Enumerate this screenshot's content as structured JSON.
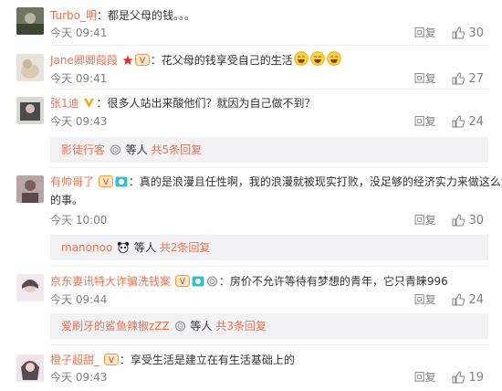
{
  "comments": [
    {
      "username": "Turbo_明",
      "text": "：都是父母的钱。。。",
      "time": "今天 09:41",
      "reply_label": "回复",
      "likes": "30",
      "emoji_count": 0
    },
    {
      "username": "Jane卿卿葭葭",
      "text": "：花父母的钱享受自己的生活",
      "time": "今天 09:41",
      "reply_label": "回复",
      "likes": "27",
      "emoji_count": 3
    },
    {
      "username": "张1迪",
      "text": "：很多人站出来酸他们？就因为自己做不到？",
      "time": "今天 09:43",
      "reply_label": "回复",
      "likes": "24",
      "sub": {
        "username": "影徒行客",
        "people_label": "等人",
        "count_label": "共5条回复"
      }
    },
    {
      "username": "有帅哥了",
      "text": "：真的是浪漫且任性啊，我的浪漫就被现实打败，没足够的经济实力来做这么浪漫",
      "text2": "的事。",
      "time": "今天 10:00",
      "reply_label": "回复",
      "likes": "30",
      "sub": {
        "username": "manonoo",
        "people_label": "等人",
        "count_label": "共2条回复"
      }
    },
    {
      "username": "京东妻讯特大诈骗洗钱案",
      "text": "：房价不允许等待有梦想的青年，它只青睐996",
      "time": "今天 09:44",
      "reply_label": "回复",
      "likes": "24",
      "sub": {
        "username": "爱刷牙的鲨鱼辣椒zZZ",
        "people_label": "等人",
        "count_label": "共3条回复"
      }
    },
    {
      "username": "橙子超甜_",
      "text": "：享受生活是建立在有生活基础上的",
      "time": "今天 09:43",
      "reply_label": "回复",
      "likes": "19"
    }
  ],
  "colors": {
    "username": "#eb7350",
    "meta": "#808080",
    "subpanel": "#f2f2f5",
    "verified_gold": "#f5a623"
  }
}
